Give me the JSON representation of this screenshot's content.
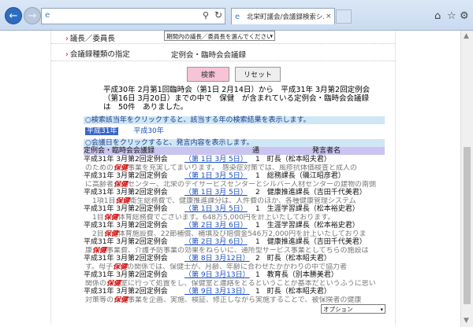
{
  "browser": {
    "tab_title": "北栄町議会/会議録検索シ...",
    "tab_close": "×"
  },
  "form": {
    "member_label": "議長／委員長",
    "member_select": "期間内の議長／委員長を選んでください",
    "type_label": "会議録種類の指定",
    "type_value": "定例会・臨時会会議録",
    "search_button": "検索",
    "reset_button": "リセット"
  },
  "summary": {
    "line1": "平成30年 2月第1回臨時会（第1日 2月14日）から　平成31年 3月第2回定例会",
    "line2": "（第16日 3月20日）までの中で　保健　が含まれている定例会・臨時会会議録",
    "line3": "は　50件　ありました。"
  },
  "year_section": {
    "heading": "○検索該当年をクリックすると、該当する年の検索結果を表示します。",
    "years": [
      "平成31年",
      "平成30年"
    ]
  },
  "results_section": {
    "heading": "○会議日をクリックすると、発言内容を表示します。",
    "col_meeting": "定例会・臨時会会議録",
    "col_no": "通",
    "col_speaker": "発言者名"
  },
  "results": [
    {
      "meeting": "平成31年 3月第2回定例会",
      "date": "（第 1日 3月 5日）",
      "no": "1",
      "speaker": "町長（松本昭夫君）"
    },
    {
      "meeting": "平成31年 3月第2回定例会",
      "date": "（第 1日 3月 5日）",
      "no": "1",
      "speaker": "総務課長（磯江昭彦君）"
    },
    {
      "meeting": "平成31年 3月第2回定例会",
      "date": "（第 1日 3月 5日）",
      "no": "2",
      "speaker": "健康推進課長（吉田千代美君）"
    },
    {
      "meeting": "平成31年 3月第2回定例会",
      "date": "（第 1日 3月 5日）",
      "no": "1",
      "speaker": "生涯学習課長（松本裕史君）"
    },
    {
      "meeting": "平成31年 3月第2回定例会",
      "date": "（第 2日 3月 6日）",
      "no": "1",
      "speaker": "生涯学習課長（松本裕史君）"
    },
    {
      "meeting": "平成31年 3月第2回定例会",
      "date": "（第 2日 3月 6日）",
      "no": "1",
      "speaker": "健康推進課長（吉田千代美君）"
    },
    {
      "meeting": "平成31年 3月第2回定例会",
      "date": "（第 8日 3月12日）",
      "no": "2",
      "speaker": "町長（松本昭夫君）"
    },
    {
      "meeting": "平成31年 3月第2回定例会",
      "date": "（第 9日 3月13日）",
      "no": "1",
      "speaker": "教育長（別本勝美君）"
    },
    {
      "meeting": "平成31年 3月第2回定例会",
      "date": "（第 9日 3月13日）",
      "no": "1",
      "speaker": "町長（松本昭夫君）"
    }
  ],
  "snippets": [
    {
      "pre": "のための",
      "kw": "保健",
      "post": "事業を充実してまいります。　感染症対策では、風疹抗体価検査と成人の"
    },
    {
      "pre": "に高齢者",
      "kw": "保健",
      "post": "センター、北栄のデイサービスセンターとシルバー人材センターの建物の南側"
    },
    {
      "pre": "　1項1目",
      "kw": "保健",
      "post": "衛生総務費で、健康推進課分は、人件費のほか、各種健康管理システム"
    },
    {
      "pre": "　1目",
      "kw": "保健",
      "post": "体育総務費でございます。648万5,000円を計上いたしております。"
    },
    {
      "pre": "　2目",
      "kw": "保健",
      "post": "体育施設費、22節補償、補填及び賠償金546万2,000円を計上いたしておりま"
    },
    {
      "pre": "康",
      "kw": "保健",
      "post": "事業費、介護予防事業の効果をねらいに、通所型サービス事業としてちらの施設は"
    },
    {
      "pre": "す。母子",
      "kw": "保健",
      "post": "の関係では、保健士が、月齢、年齢に合わせたかかわりの中で協力者"
    },
    {
      "pre": "関係の",
      "kw": "保健",
      "post": "室に行って処置をし、保健室と連絡をとるということが基本だというふうに思い"
    },
    {
      "pre": "対策等の",
      "kw": "保健",
      "post": "事業を企画、実施、検証、修正しながら実施することで、被保険者の健康"
    }
  ],
  "option_select": "オプション"
}
